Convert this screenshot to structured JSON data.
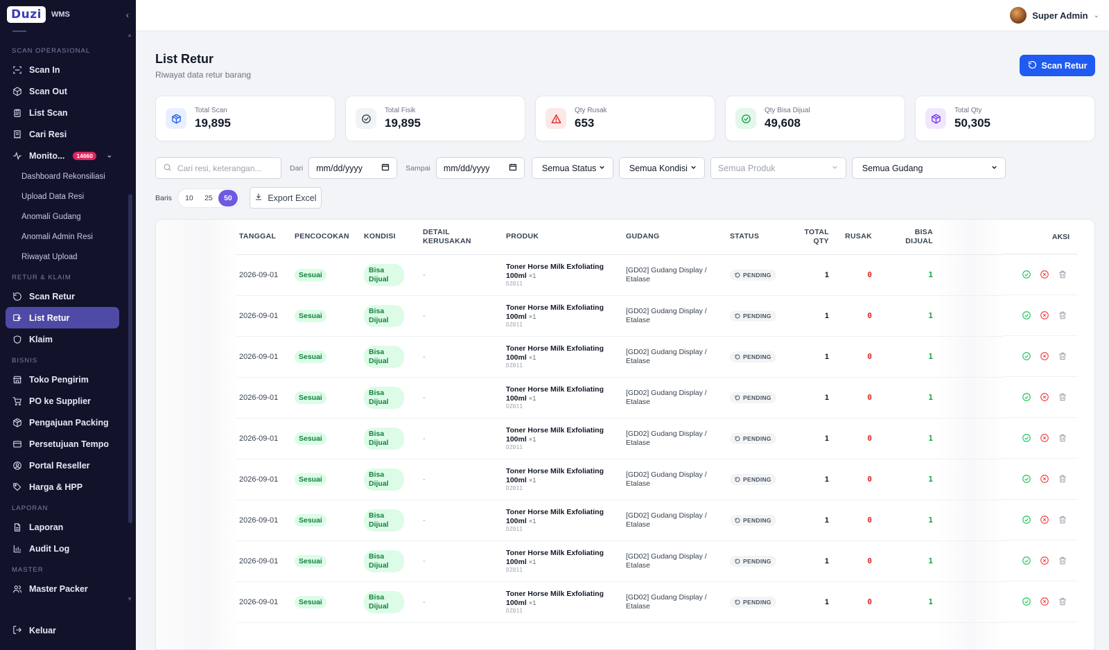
{
  "brand": {
    "logo": "Duzi",
    "sub": "WMS"
  },
  "sidebar": {
    "sections": [
      {
        "title": "SCAN OPERASIONAL",
        "items": [
          {
            "label": "Scan In",
            "icon": "scan-icon"
          },
          {
            "label": "Scan Out",
            "icon": "box-icon"
          },
          {
            "label": "List Scan",
            "icon": "clipboard-icon"
          },
          {
            "label": "Cari Resi",
            "icon": "receipt-icon"
          },
          {
            "label": "Monito...",
            "icon": "monitor-icon",
            "badge": "14660",
            "expanded": true,
            "children": [
              "Dashboard Rekonsiliasi",
              "Upload Data Resi",
              "Anomali Gudang",
              "Anomali Admin Resi",
              "Riwayat Upload"
            ]
          }
        ]
      },
      {
        "title": "RETUR & KLAIM",
        "items": [
          {
            "label": "Scan Retur",
            "icon": "rotate-icon"
          },
          {
            "label": "List Retur",
            "icon": "return-list-icon",
            "active": true
          },
          {
            "label": "Klaim",
            "icon": "shield-icon"
          }
        ]
      },
      {
        "title": "BISNIS",
        "items": [
          {
            "label": "Toko Pengirim",
            "icon": "store-icon"
          },
          {
            "label": "PO ke Supplier",
            "icon": "cart-icon"
          },
          {
            "label": "Pengajuan Packing",
            "icon": "package-icon"
          },
          {
            "label": "Persetujuan Tempo",
            "icon": "card-icon"
          },
          {
            "label": "Portal Reseller",
            "icon": "user-circle-icon"
          },
          {
            "label": "Harga & HPP",
            "icon": "tag-icon"
          }
        ]
      },
      {
        "title": "LAPORAN",
        "items": [
          {
            "label": "Laporan",
            "icon": "file-icon"
          },
          {
            "label": "Audit Log",
            "icon": "bar-chart-icon"
          }
        ]
      },
      {
        "title": "MASTER",
        "items": [
          {
            "label": "Master Packer",
            "icon": "users-icon"
          }
        ]
      }
    ],
    "logout": "Keluar"
  },
  "user": {
    "name": "Super Admin"
  },
  "page": {
    "title": "List Retur",
    "subtitle": "Riwayat data retur barang",
    "scan_button": "Scan Retur"
  },
  "stats": [
    {
      "label": "Total Scan",
      "value": "19,895",
      "icon": "package-icon",
      "color": "#2563eb",
      "bg": "#e8efff"
    },
    {
      "label": "Total Fisik",
      "value": "19,895",
      "icon": "check-circle-icon",
      "color": "#374151",
      "bg": "#f1f3f5"
    },
    {
      "label": "Qty Rusak",
      "value": "653",
      "icon": "alert-triangle-icon",
      "color": "#dc2626",
      "bg": "#fde8e8"
    },
    {
      "label": "Qty Bisa Dijual",
      "value": "49,608",
      "icon": "check-circle-icon",
      "color": "#16a34a",
      "bg": "#e3f7ea"
    },
    {
      "label": "Total Qty",
      "value": "50,305",
      "icon": "package-icon",
      "color": "#7c3aed",
      "bg": "#efe8fd"
    }
  ],
  "filters": {
    "search_placeholder": "Cari resi, keterangan...",
    "dari_label": "Dari",
    "sampai_label": "Sampai",
    "date_placeholder": "mm/dd/yyyy",
    "status": "Semua Status",
    "kondisi": "Semua Kondisi",
    "produk": "Semua Produk",
    "gudang": "Semua Gudang"
  },
  "rows_label": "Baris",
  "page_sizes": [
    "10",
    "25",
    "50"
  ],
  "page_size_selected": "50",
  "export_label": "Export Excel",
  "table": {
    "headers": {
      "tanggal": "TANGGAL",
      "pencocokan": "PENCOCOKAN",
      "kondisi": "KONDISI",
      "detail": "DETAIL KERUSAKAN",
      "produk": "PRODUK",
      "gudang": "GUDANG",
      "status": "STATUS",
      "total_qty": "TOTAL QTY",
      "rusak": "RUSAK",
      "bisa_dijual": "BISA DIJUAL",
      "aksi": "AKSI"
    },
    "rows": [
      {
        "tanggal": "2026-09-01",
        "pencocokan": "Sesuai",
        "kondisi": "Bisa Dijual",
        "detail": "-",
        "produk": "Toner Horse Milk Exfoliating 100ml",
        "qty_x": "×1",
        "sku": "DZ011",
        "gudang": "[GD02] Gudang Display / Etalase",
        "status": "PENDING",
        "total_qty": "1",
        "rusak": "0",
        "bisa_dijual": "1"
      },
      {
        "tanggal": "2026-09-01",
        "pencocokan": "Sesuai",
        "kondisi": "Bisa Dijual",
        "detail": "-",
        "produk": "Toner Horse Milk Exfoliating 100ml",
        "qty_x": "×1",
        "sku": "DZ011",
        "gudang": "[GD02] Gudang Display / Etalase",
        "status": "PENDING",
        "total_qty": "1",
        "rusak": "0",
        "bisa_dijual": "1"
      },
      {
        "tanggal": "2026-09-01",
        "pencocokan": "Sesuai",
        "kondisi": "Bisa Dijual",
        "detail": "-",
        "produk": "Toner Horse Milk Exfoliating 100ml",
        "qty_x": "×1",
        "sku": "DZ011",
        "gudang": "[GD02] Gudang Display / Etalase",
        "status": "PENDING",
        "total_qty": "1",
        "rusak": "0",
        "bisa_dijual": "1"
      },
      {
        "tanggal": "2026-09-01",
        "pencocokan": "Sesuai",
        "kondisi": "Bisa Dijual",
        "detail": "-",
        "produk": "Toner Horse Milk Exfoliating 100ml",
        "qty_x": "×1",
        "sku": "DZ011",
        "gudang": "[GD02] Gudang Display / Etalase",
        "status": "PENDING",
        "total_qty": "1",
        "rusak": "0",
        "bisa_dijual": "1"
      },
      {
        "tanggal": "2026-09-01",
        "pencocokan": "Sesuai",
        "kondisi": "Bisa Dijual",
        "detail": "-",
        "produk": "Toner Horse Milk Exfoliating 100ml",
        "qty_x": "×1",
        "sku": "DZ011",
        "gudang": "[GD02] Gudang Display / Etalase",
        "status": "PENDING",
        "total_qty": "1",
        "rusak": "0",
        "bisa_dijual": "1"
      },
      {
        "tanggal": "2026-09-01",
        "pencocokan": "Sesuai",
        "kondisi": "Bisa Dijual",
        "detail": "-",
        "produk": "Toner Horse Milk Exfoliating 100ml",
        "qty_x": "×1",
        "sku": "DZ011",
        "gudang": "[GD02] Gudang Display / Etalase",
        "status": "PENDING",
        "total_qty": "1",
        "rusak": "0",
        "bisa_dijual": "1"
      },
      {
        "tanggal": "2026-09-01",
        "pencocokan": "Sesuai",
        "kondisi": "Bisa Dijual",
        "detail": "-",
        "produk": "Toner Horse Milk Exfoliating 100ml",
        "qty_x": "×1",
        "sku": "DZ011",
        "gudang": "[GD02] Gudang Display / Etalase",
        "status": "PENDING",
        "total_qty": "1",
        "rusak": "0",
        "bisa_dijual": "1"
      },
      {
        "tanggal": "2026-09-01",
        "pencocokan": "Sesuai",
        "kondisi": "Bisa Dijual",
        "detail": "-",
        "produk": "Toner Horse Milk Exfoliating 100ml",
        "qty_x": "×1",
        "sku": "DZ011",
        "gudang": "[GD02] Gudang Display / Etalase",
        "status": "PENDING",
        "total_qty": "1",
        "rusak": "0",
        "bisa_dijual": "1"
      },
      {
        "tanggal": "2026-09-01",
        "pencocokan": "Sesuai",
        "kondisi": "Bisa Dijual",
        "detail": "-",
        "produk": "Toner Horse Milk Exfoliating 100ml",
        "qty_x": "×1",
        "sku": "DZ011",
        "gudang": "[GD02] Gudang Display / Etalase",
        "status": "PENDING",
        "total_qty": "1",
        "rusak": "0",
        "bisa_dijual": "1"
      }
    ]
  }
}
